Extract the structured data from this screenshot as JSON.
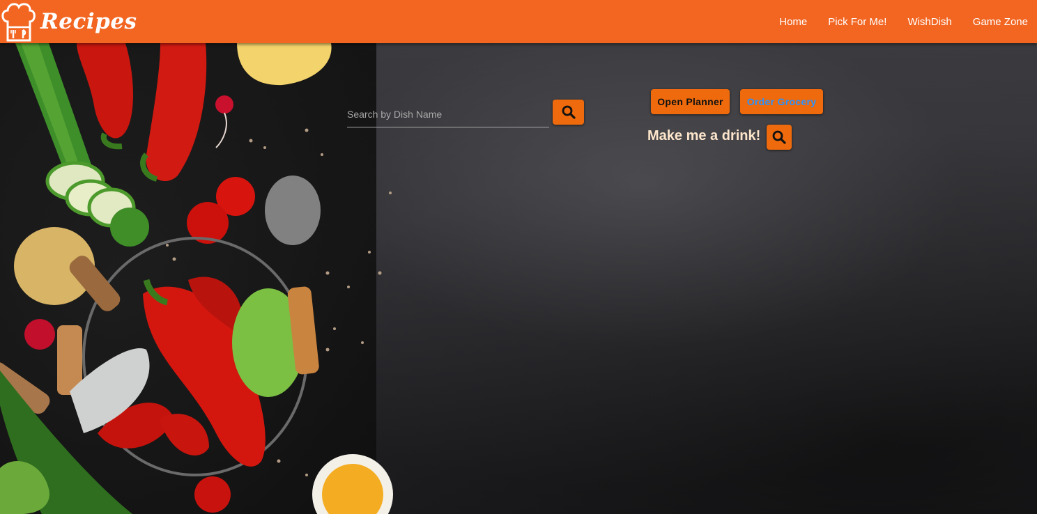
{
  "brand": {
    "name": "Recipes",
    "logo_icon": "chef-hat-icon",
    "logo_color": "#ffffff"
  },
  "nav": {
    "items": [
      {
        "label": "Home"
      },
      {
        "label": "Pick For Me!"
      },
      {
        "label": "WishDish"
      },
      {
        "label": "Game Zone"
      }
    ]
  },
  "search": {
    "placeholder": "Search by Dish Name",
    "value": "",
    "button_icon": "search-icon"
  },
  "planner": {
    "open_label": "Open Planner",
    "grocery_label": "Order Grocery"
  },
  "drink": {
    "label": "Make me a drink!",
    "button_icon": "search-icon"
  },
  "colors": {
    "navbar": "#f26622",
    "button": "#ee6a0c",
    "grocery_text": "#2a92ff",
    "drink_text": "#fde6cc"
  }
}
